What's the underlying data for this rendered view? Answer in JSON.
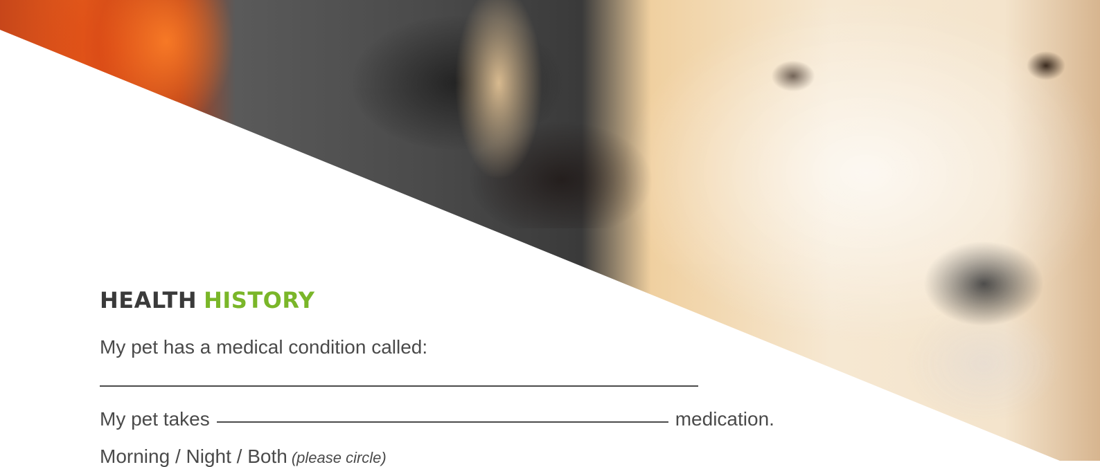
{
  "document": {
    "title": {
      "part1": "HEALTH",
      "part2": "HISTORY"
    },
    "lines": [
      {
        "text": "My pet has a medical condition called:"
      },
      {
        "blank": ""
      },
      {
        "prefix": "My pet takes",
        "suffix": "medication."
      },
      {
        "text": "Morning / Night / Both",
        "hint": "(please circle)"
      }
    ]
  },
  "colors": {
    "accent_green": "#7ab629",
    "text_gray": "#4a4a4a"
  }
}
